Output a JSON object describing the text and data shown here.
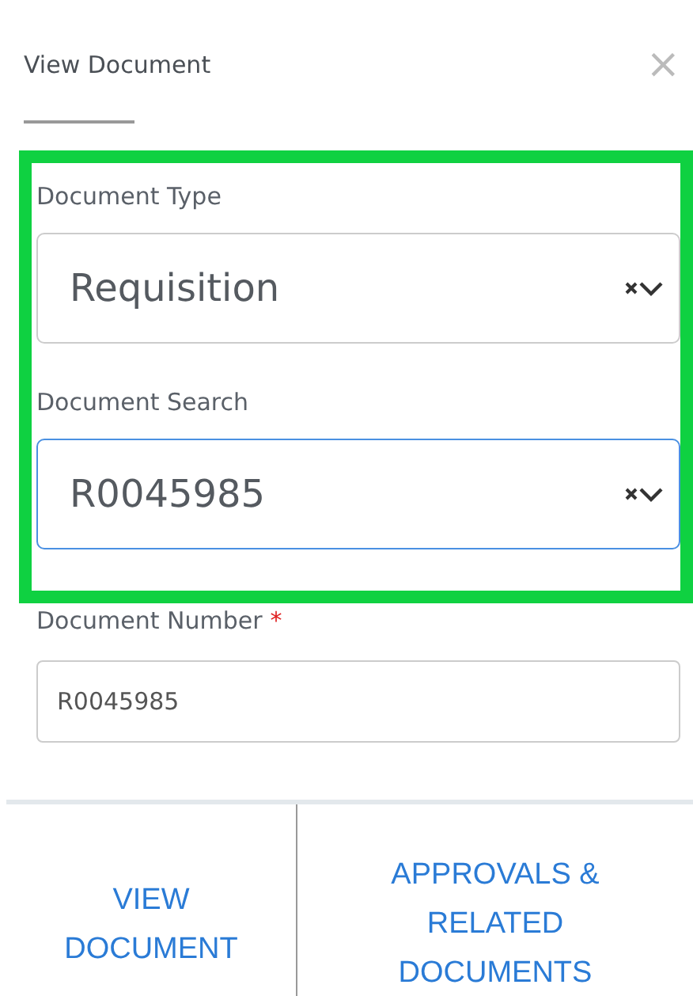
{
  "dialog": {
    "title": "View Document",
    "close": "×"
  },
  "highlighted_fields": [
    {
      "kind": "select",
      "label": "Document Type",
      "value": "Requisition",
      "focused": false
    },
    {
      "kind": "select",
      "label": "Document Search",
      "value": "R0045985",
      "focused": true
    }
  ],
  "fields": [
    {
      "kind": "input",
      "label": "Document Number",
      "required": true,
      "required_mark": "*",
      "value": "R0045985"
    }
  ],
  "actions": [
    {
      "lines": [
        "VIEW",
        "DOCUMENT"
      ]
    },
    {
      "lines": [
        "APPROVALS &",
        "RELATED",
        "DOCUMENTS"
      ]
    }
  ]
}
